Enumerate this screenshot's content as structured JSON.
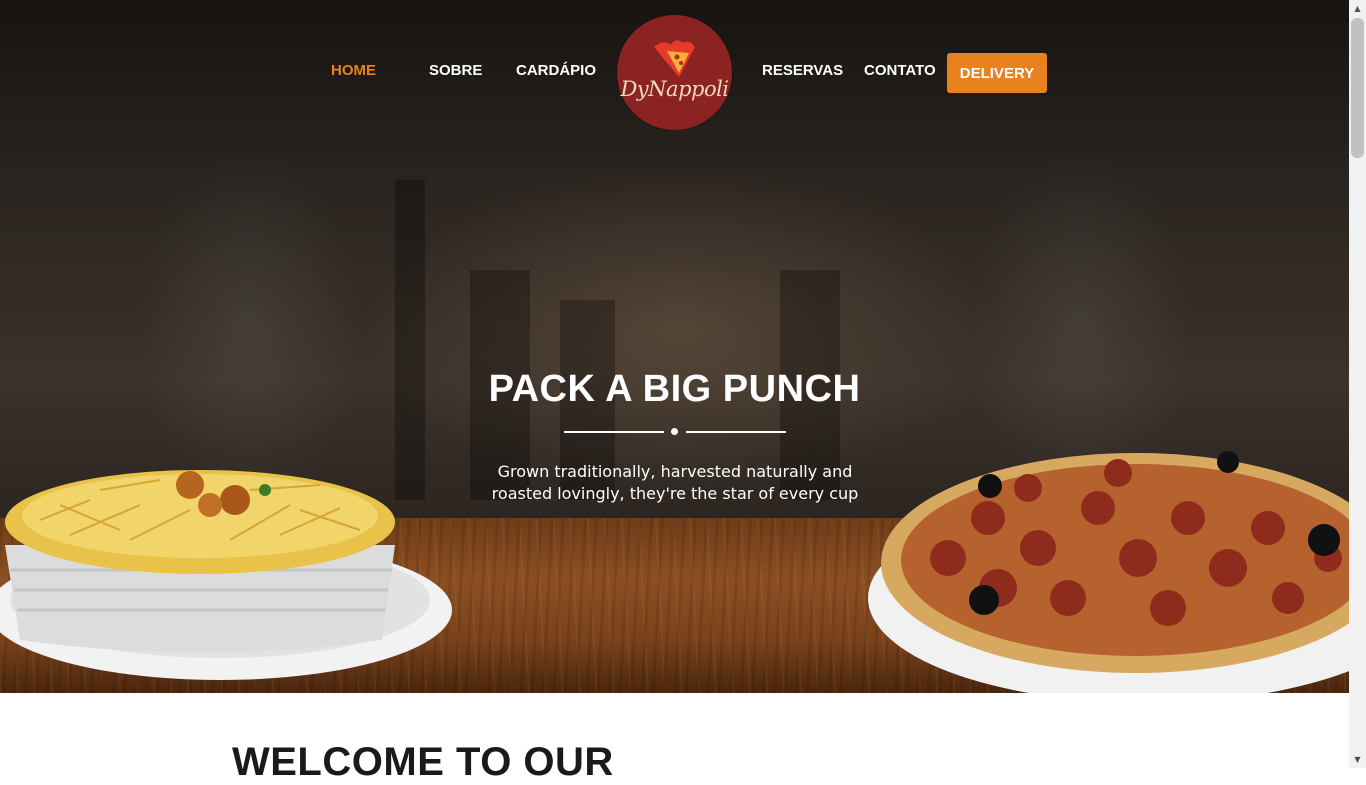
{
  "nav": {
    "left_links": [
      {
        "label": "HOME"
      },
      {
        "label": "SOBRE"
      },
      {
        "label": "CARDÁPIO"
      }
    ],
    "right_links": [
      {
        "label": "RESERVAS"
      },
      {
        "label": "CONTATO"
      }
    ],
    "delivery_label": "DELIVERY",
    "active_link": "HOME",
    "accent_color": "#e8821e"
  },
  "logo": {
    "text": "DyNappoli",
    "color": "#8b2323"
  },
  "hero": {
    "title": "PACK A BIG PUNCH",
    "subtitle": "Grown traditionally, harvested naturally and roasted lovingly, they're the star of every cup",
    "left_dish_icon": "pasta-dish-icon",
    "right_dish_icon": "pepperoni-pizza-icon"
  },
  "welcome": {
    "heading": "WELCOME TO OUR"
  }
}
